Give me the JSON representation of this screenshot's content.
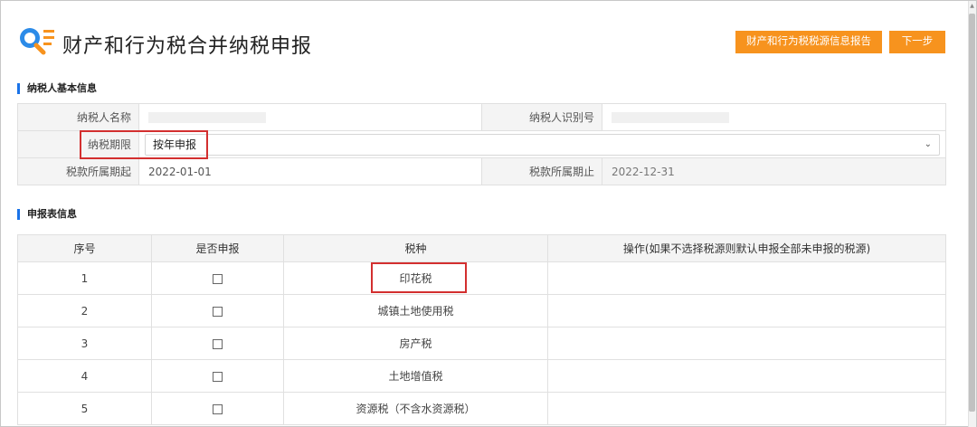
{
  "header": {
    "title": "财产和行为税合并纳税申报",
    "report_button": "财产和行为税税源信息报告",
    "next_button": "下一步"
  },
  "taxpayer_info": {
    "section_title": "纳税人基本信息",
    "name_label": "纳税人名称",
    "name_value": "",
    "id_label": "纳税人识别号",
    "id_value": "",
    "period_label": "纳税期限",
    "period_value": "按年申报",
    "start_label": "税款所属期起",
    "start_value": "2022-01-01",
    "end_label": "税款所属期止",
    "end_value": "2022-12-31"
  },
  "declaration": {
    "section_title": "申报表信息",
    "columns": [
      "序号",
      "是否申报",
      "税种",
      "操作(如果不选择税源则默认申报全部未申报的税源)"
    ],
    "rows": [
      {
        "no": "1",
        "tax": "印花税",
        "checked": false
      },
      {
        "no": "2",
        "tax": "城镇土地使用税",
        "checked": false
      },
      {
        "no": "3",
        "tax": "房产税",
        "checked": false
      },
      {
        "no": "4",
        "tax": "土地增值税",
        "checked": false
      },
      {
        "no": "5",
        "tax": "资源税（不含水资源税）",
        "checked": false
      }
    ]
  },
  "colors": {
    "accent_orange": "#f7931e",
    "section_bar_blue": "#1a73e8",
    "highlight_red": "#d32f2f"
  },
  "icons": {
    "logo": "search-document-icon",
    "select_arrow": "chevron-down-icon",
    "checkbox": "checkbox-icon"
  }
}
